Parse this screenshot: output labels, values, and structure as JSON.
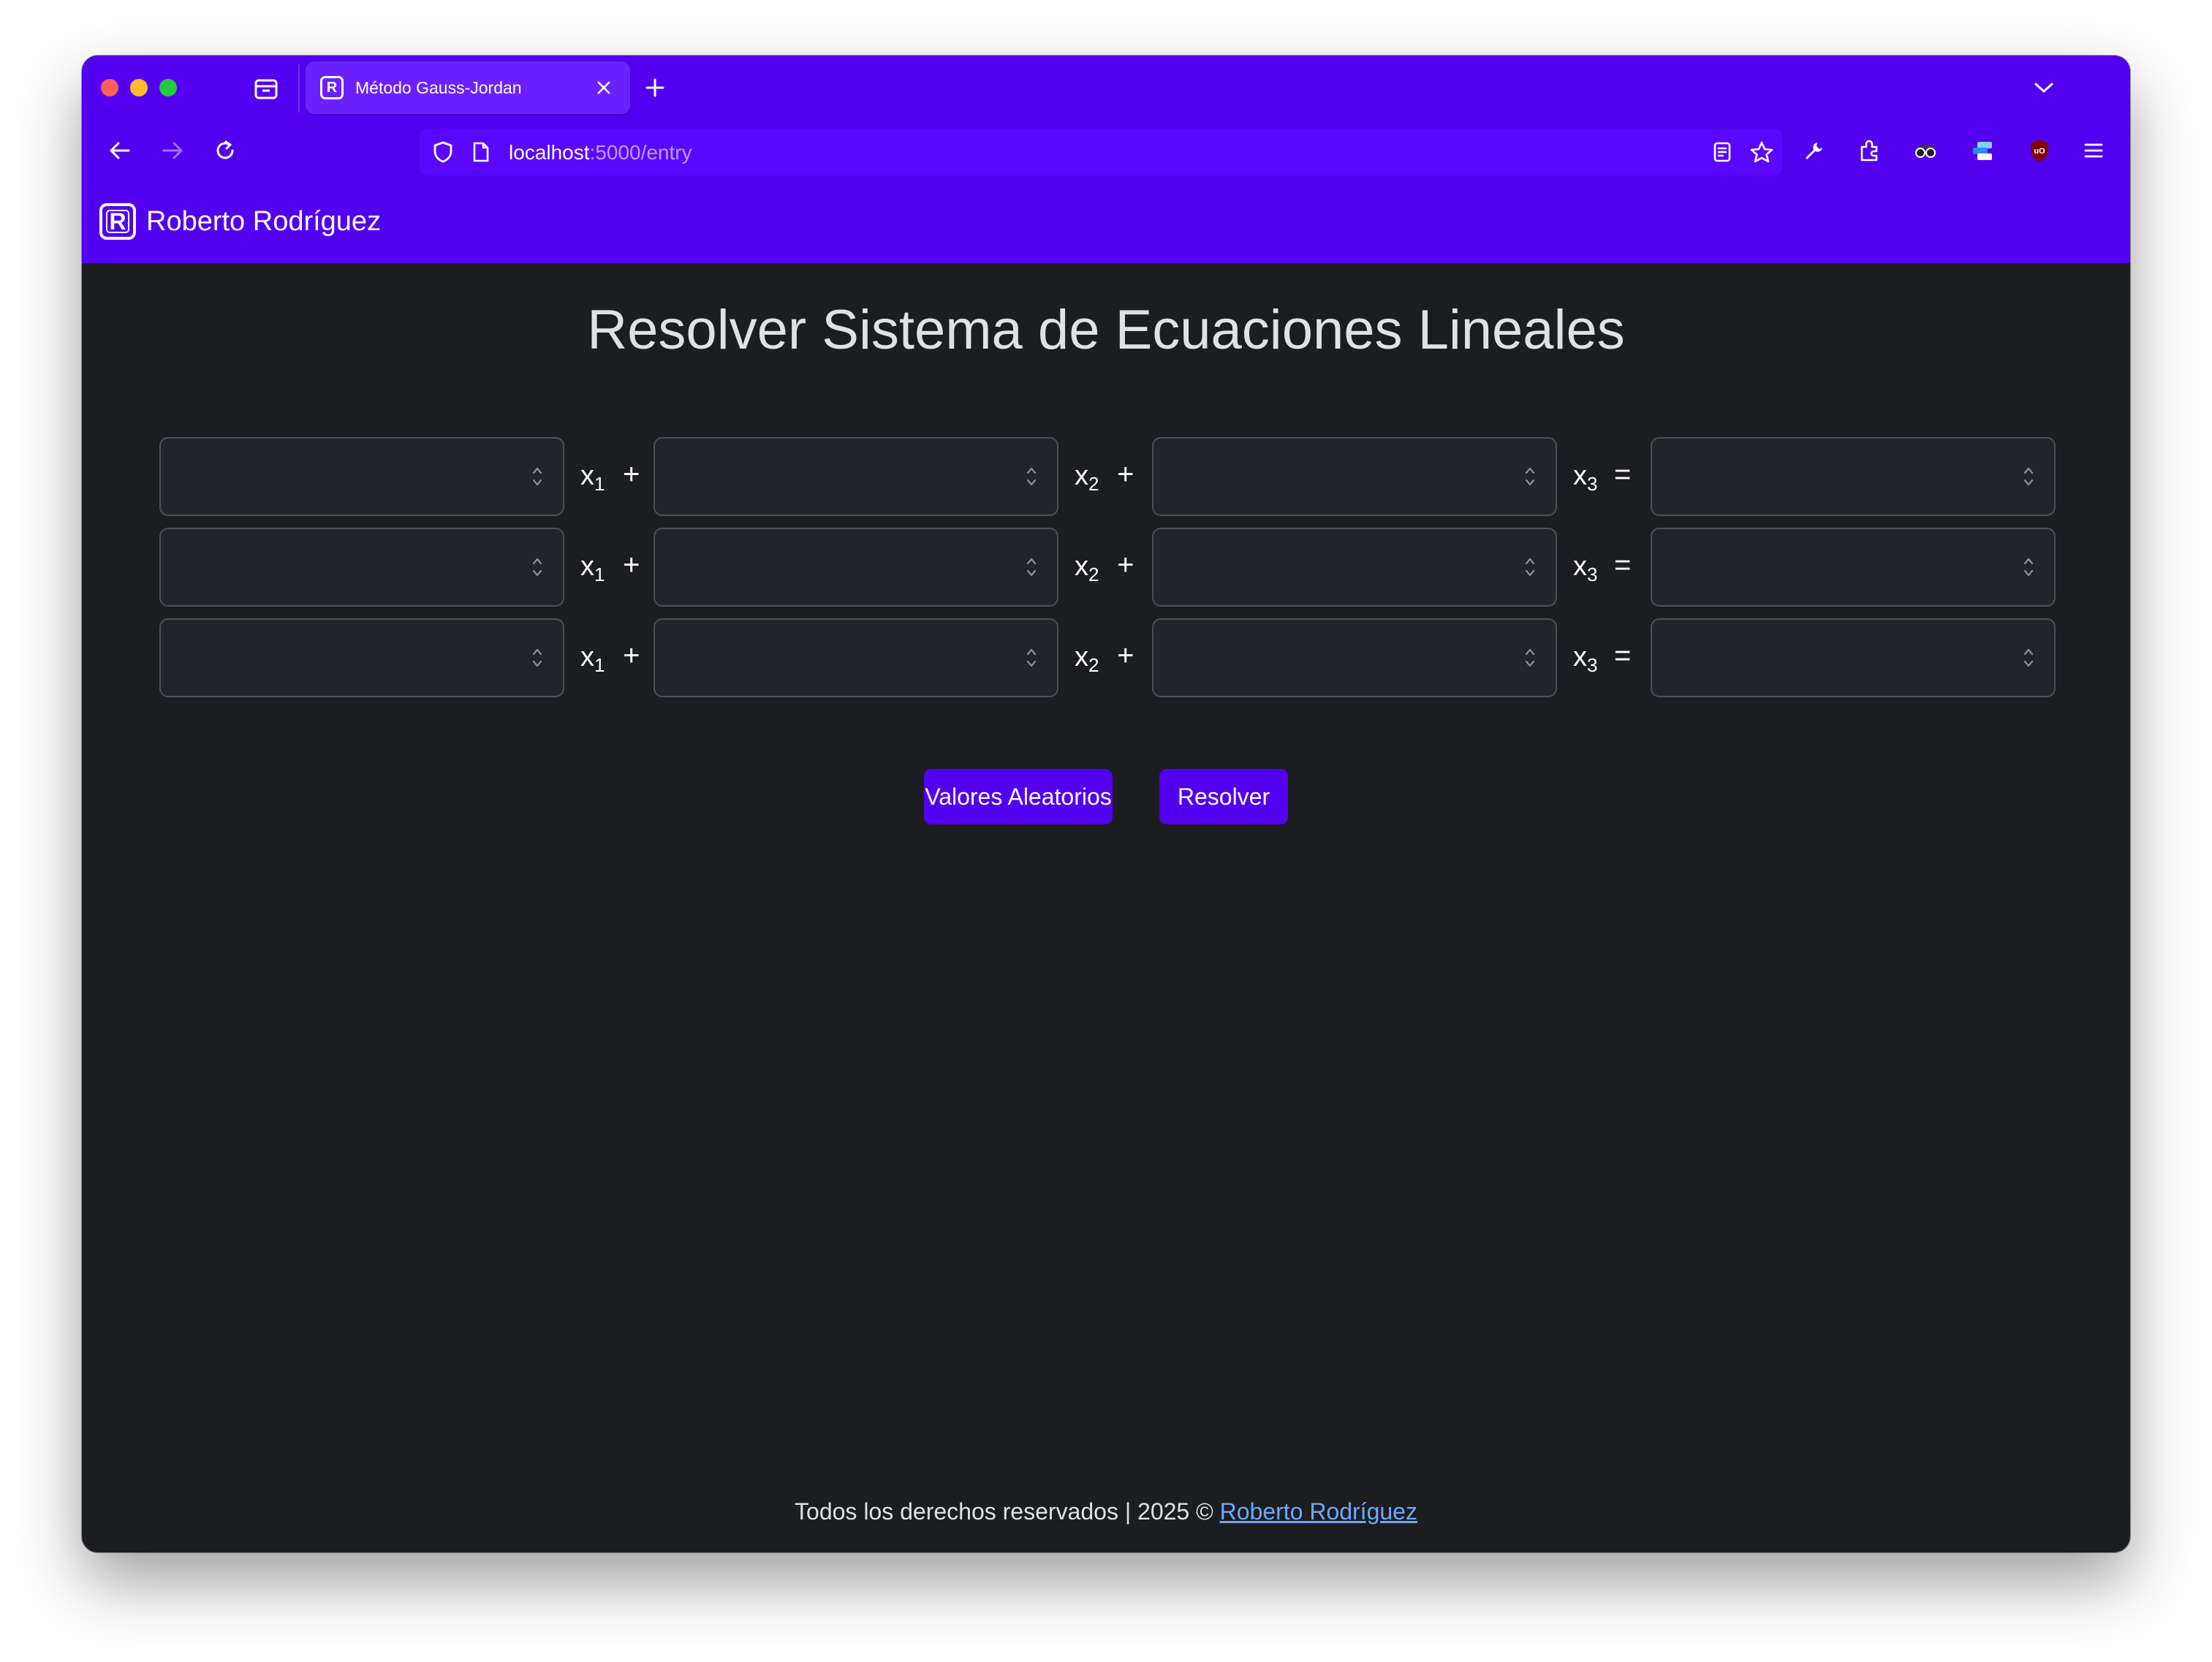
{
  "browser": {
    "tab": {
      "title": "Método Gauss-Jordan",
      "favicon": "R"
    },
    "url": {
      "host": "localhost",
      "rest": ":5000/entry"
    }
  },
  "site": {
    "brand": {
      "logo": "R",
      "name": "Roberto Rodríguez"
    }
  },
  "main": {
    "title": "Resolver Sistema de Ecuaciones Lineales",
    "variables": [
      "x",
      "x",
      "x"
    ],
    "subscripts": [
      "1",
      "2",
      "3"
    ],
    "operators": {
      "plus": "+",
      "equals": "="
    },
    "buttons": {
      "random": "Valores Aleatorios",
      "solve": "Resolver"
    }
  },
  "footer": {
    "text": "Todos los derechos reservados | 2025 ©",
    "link": "Roberto Rodríguez"
  },
  "colors": {
    "accent": "#5300f0",
    "background": "#1b1d20",
    "link": "#6ea8fe"
  }
}
